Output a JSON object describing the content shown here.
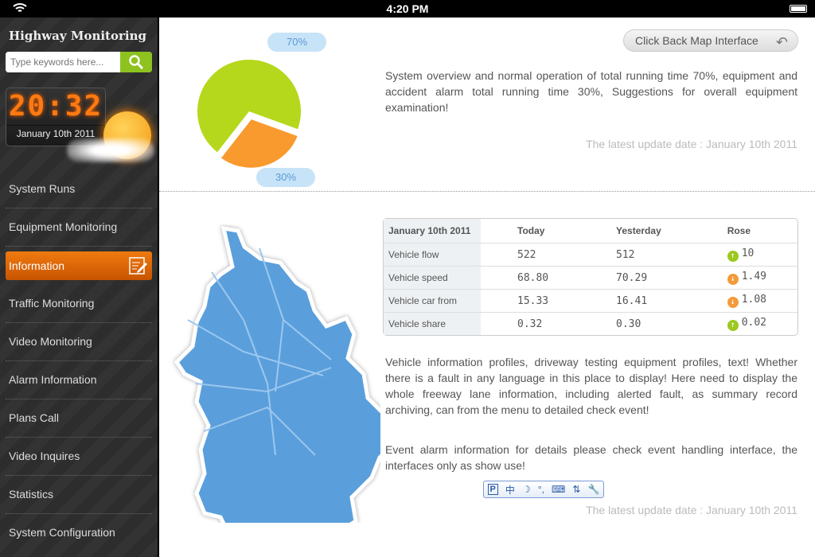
{
  "status_bar": {
    "time": "4:20 PM"
  },
  "sidebar": {
    "title": "Highway Monitoring",
    "search_placeholder": "Type keywords here...",
    "clock_time": "20:32",
    "clock_date": "January 10th 2011",
    "items": [
      {
        "label": "System Runs"
      },
      {
        "label": "Equipment Monitoring"
      },
      {
        "label": "Information",
        "active": true
      },
      {
        "label": "Traffic Monitoring"
      },
      {
        "label": "Video Monitoring"
      },
      {
        "label": "Alarm Information"
      },
      {
        "label": "Plans Call"
      },
      {
        "label": "Video Inquires"
      },
      {
        "label": "Statistics"
      },
      {
        "label": "System Configuration"
      }
    ]
  },
  "overview": {
    "back_button": "Click Back Map Interface",
    "pie": {
      "label_running": "70%",
      "label_alarm": "30%",
      "running": 70,
      "alarm": 30,
      "colors": {
        "running": "#b5d81c",
        "alarm": "#f99a2e"
      }
    },
    "text": "System overview and normal operation of total running time 70%, equipment and accident alarm total running time 30%, Suggestions for overall equipment examination!",
    "update": "The latest update date : January 10th 2011"
  },
  "vehicle": {
    "table": {
      "headers": [
        "January 10th 2011",
        "Today",
        "Yesterday",
        "Rose"
      ],
      "rows": [
        {
          "label": "Vehicle flow",
          "today": "522",
          "yesterday": "512",
          "rose": "10",
          "trend": "up"
        },
        {
          "label": "Vehicle speed",
          "today": "68.80",
          "yesterday": "70.29",
          "rose": "1.49",
          "trend": "down"
        },
        {
          "label": "Vehicle car from",
          "today": "15.33",
          "yesterday": "16.41",
          "rose": "1.08",
          "trend": "down"
        },
        {
          "label": "Vehicle share",
          "today": "0.32",
          "yesterday": "0.30",
          "rose": "0.02",
          "trend": "up"
        }
      ]
    },
    "text1": "Vehicle information profiles, driveway testing equipment profiles, text! Whether there is a fault in any language in this place to display! Here need to display the whole freeway lane information, including alerted fault, as summary record archiving, can from the menu to detailed check event!",
    "text2": "Event alarm information for details please check event handling interface, the interfaces only as show use!",
    "update": "The latest update date : January 10th 2011",
    "ime_chars": [
      "中",
      "°,"
    ]
  },
  "colors": {
    "accent": "#e8700c",
    "search": "#8dc21f",
    "up": "#9cc820",
    "down": "#f39a3a",
    "map": "#5a9fdc"
  }
}
